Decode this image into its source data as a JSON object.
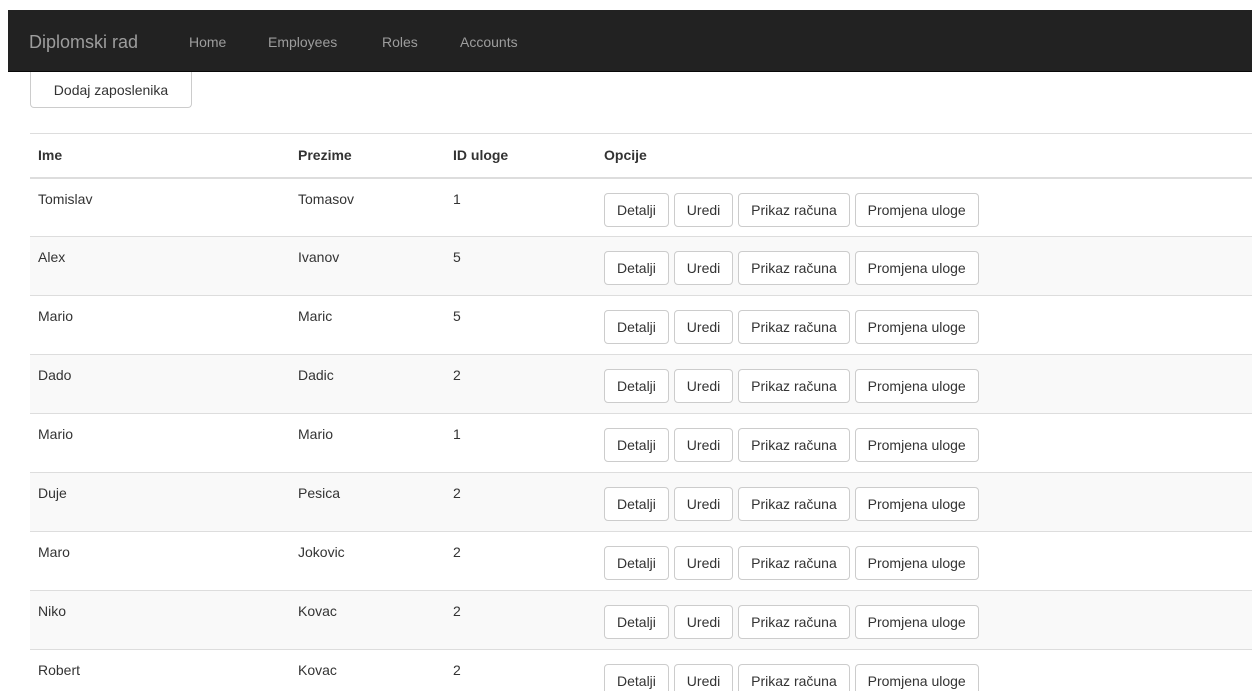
{
  "navbar": {
    "brand": "Diplomski rad",
    "links": [
      "Home",
      "Employees",
      "Roles",
      "Accounts"
    ]
  },
  "add_button": "Dodaj zaposlenika",
  "table": {
    "headers": [
      "Ime",
      "Prezime",
      "ID uloge",
      "Opcije"
    ],
    "actions": [
      "Detalji",
      "Uredi",
      "Prikaz računa",
      "Promjena uloge"
    ],
    "rows": [
      {
        "ime": "Tomislav",
        "prezime": "Tomasov",
        "id": "1"
      },
      {
        "ime": "Alex",
        "prezime": "Ivanov",
        "id": "5"
      },
      {
        "ime": "Mario",
        "prezime": "Maric",
        "id": "5"
      },
      {
        "ime": "Dado",
        "prezime": "Dadic",
        "id": "2"
      },
      {
        "ime": "Mario",
        "prezime": "Mario",
        "id": "1"
      },
      {
        "ime": "Duje",
        "prezime": "Pesica",
        "id": "2"
      },
      {
        "ime": "Maro",
        "prezime": "Jokovic",
        "id": "2"
      },
      {
        "ime": "Niko",
        "prezime": "Kovac",
        "id": "2"
      },
      {
        "ime": "Robert",
        "prezime": "Kovac",
        "id": "2"
      }
    ]
  }
}
